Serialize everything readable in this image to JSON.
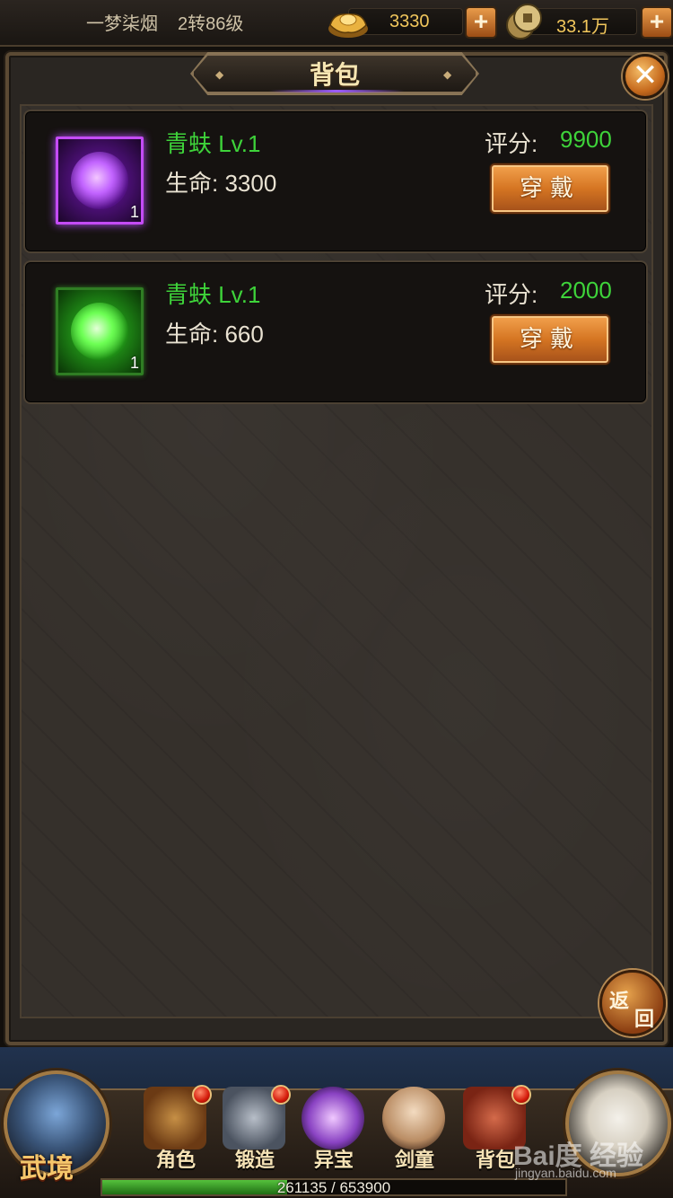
{
  "topbar": {
    "player_name": "一梦柒烟",
    "player_level": "2转86级",
    "gold": "3330",
    "coins": "33.1万",
    "gold_icon": "gold-ingot-icon",
    "coin_icon": "copper-coins-icon",
    "plus_label": "+"
  },
  "window": {
    "title": "背包",
    "close_label": "✕",
    "return_label_1": "返",
    "return_label_2": "回"
  },
  "items": [
    {
      "name": "青蚨 Lv.1",
      "stat": "生命: 3300",
      "score_label": "评分:",
      "score": "9900",
      "count": "1",
      "rarity_color": "#c44bf5",
      "equip_label": "穿戴"
    },
    {
      "name": "青蚨 Lv.1",
      "stat": "生命: 660",
      "score_label": "评分:",
      "score": "2000",
      "count": "1",
      "rarity_color": "#2f7d23",
      "equip_label": "穿戴"
    }
  ],
  "bottom_nav": {
    "main_label": "武境",
    "items": [
      {
        "label": "角色",
        "icon": "armor-icon",
        "badge": true
      },
      {
        "label": "锻造",
        "icon": "anvil-icon",
        "badge": true
      },
      {
        "label": "异宝",
        "icon": "orb-icon",
        "badge": false
      },
      {
        "label": "剑童",
        "icon": "sword-boy-icon",
        "badge": false
      },
      {
        "label": "背包",
        "icon": "bag-icon",
        "badge": true
      }
    ],
    "panda_icon": "panda-icon"
  },
  "exp": {
    "current": 261135,
    "max": 653900,
    "text": "261135 / 653900"
  },
  "watermark": {
    "text": "Bai度 经验",
    "url": "jingyan.baidu.com"
  }
}
